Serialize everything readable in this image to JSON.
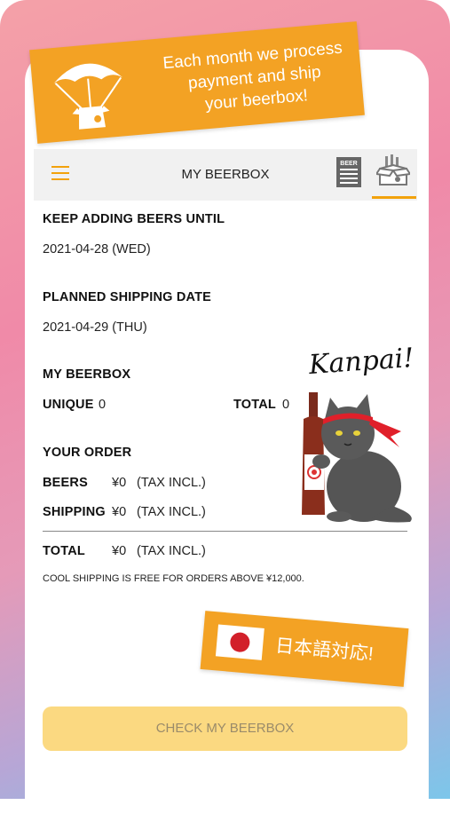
{
  "banner": {
    "lines": [
      "Each month we process",
      "payment and ship",
      "your beerbox!"
    ]
  },
  "header": {
    "title": "MY BEERBOX",
    "beer_tab_label": "BEER"
  },
  "add_until": {
    "label": "KEEP ADDING BEERS UNTIL",
    "value": "2021-04-28 (WED)"
  },
  "shipping_date": {
    "label": "PLANNED SHIPPING DATE",
    "value": "2021-04-29 (THU)"
  },
  "beerbox": {
    "label": "MY BEERBOX",
    "unique_label": "UNIQUE",
    "unique_value": "0",
    "total_label": "TOTAL",
    "total_value": "0"
  },
  "order": {
    "label": "YOUR ORDER",
    "beers_label": "BEERS",
    "beers_value": "¥0",
    "beers_tax": "(TAX INCL.)",
    "shipping_label": "SHIPPING",
    "shipping_value": "¥0",
    "shipping_tax": "(TAX INCL.)",
    "total_label": "TOTAL",
    "total_value": "¥0",
    "total_tax": "(TAX INCL.)",
    "note": "COOL SHIPPING IS FREE FOR ORDERS ABOVE ¥12,000."
  },
  "kanpai": "Kanpai!",
  "jp_badge": "日本語対応!",
  "cta": "CHECK MY BEERBOX",
  "colors": {
    "accent": "#f3a224",
    "cta_bg": "#fbd981"
  }
}
